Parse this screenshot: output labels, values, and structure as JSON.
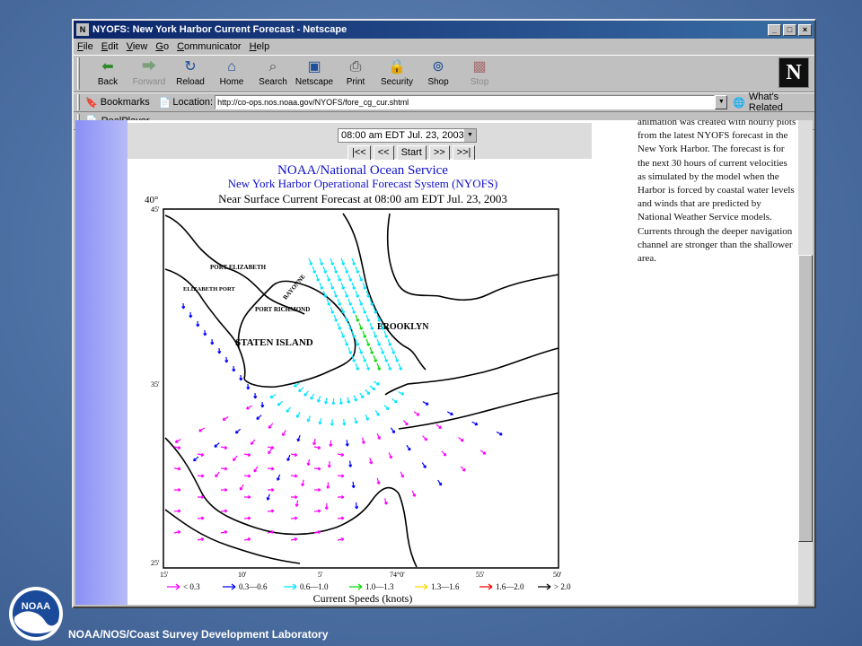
{
  "window": {
    "title": "NYOFS: New York Harbor Current Forecast - Netscape",
    "controls": [
      "_",
      "□",
      "×"
    ]
  },
  "menu": [
    "File",
    "Edit",
    "View",
    "Go",
    "Communicator",
    "Help"
  ],
  "toolbar": [
    {
      "label": "Back",
      "icon": "back-arrow-icon",
      "enabled": true
    },
    {
      "label": "Forward",
      "icon": "forward-arrow-icon",
      "enabled": false
    },
    {
      "label": "Reload",
      "icon": "reload-icon",
      "enabled": true
    },
    {
      "label": "Home",
      "icon": "home-icon",
      "enabled": true
    },
    {
      "label": "Search",
      "icon": "search-icon",
      "enabled": true
    },
    {
      "label": "Netscape",
      "icon": "netscape-icon",
      "enabled": true
    },
    {
      "label": "Print",
      "icon": "print-icon",
      "enabled": true
    },
    {
      "label": "Security",
      "icon": "security-icon",
      "enabled": true
    },
    {
      "label": "Shop",
      "icon": "shop-icon",
      "enabled": true
    },
    {
      "label": "Stop",
      "icon": "stop-icon",
      "enabled": false
    }
  ],
  "location": {
    "bookmarks_label": "Bookmarks",
    "location_label": "Location:",
    "url": "http://co-ops.nos.noaa.gov/NYOFS/fore_cg_cur.shtml",
    "whats_related": "What's Related"
  },
  "personal_bar": {
    "item": "RealPlayer"
  },
  "page": {
    "time_select": "08:00 am EDT Jul. 23, 2003",
    "nav_buttons": [
      "|<<",
      "<<",
      "Start",
      ">>",
      ">>|"
    ],
    "description": "animation was created with hourly plots from the latest NYOFS forecast in the New York Harbor. The forecast is for the next 30 hours of current velocities as simulated by the model when the Harbor is forced by coastal water levels and winds that are predicted by National Weather Service models. Currents through the deeper navigation channel are stronger than the shallower area."
  },
  "map": {
    "title1": "NOAA/National Ocean Service",
    "title2": "New York Harbor Operational Forecast System (NYOFS)",
    "title3": "Near Surface Current Forecast at 08:00 am EDT  Jul. 23, 2003",
    "lat_top": "40°",
    "lat_ticks": [
      "45'",
      "35'",
      "25'"
    ],
    "lon_ticks": [
      "15'",
      "10'",
      "5'",
      "74°0'",
      "55'",
      "50'"
    ],
    "places": [
      "PORT ELIZABETH",
      "ELIZABETH PORT",
      "PORT RICHMOND",
      "BAYONNE",
      "STATEN ISLAND",
      "BROOKLYN"
    ],
    "legend": [
      {
        "label": "< 0.3",
        "color": "#ff00ff"
      },
      {
        "label": "0.3—0.6",
        "color": "#0000ff"
      },
      {
        "label": "0.6—1.0",
        "color": "#00e5ff"
      },
      {
        "label": "1.0—1.3",
        "color": "#00dd00"
      },
      {
        "label": "1.3—1.6",
        "color": "#ffd700"
      },
      {
        "label": "1.6—2.0",
        "color": "#ff0000"
      },
      {
        "label": "> 2.0",
        "color": "#000000"
      }
    ],
    "xlabel": "Current Speeds (knots)"
  },
  "footer": {
    "text": "NOAA/NOS/Coast Survey Development Laboratory",
    "logo_text": "NOAA"
  }
}
